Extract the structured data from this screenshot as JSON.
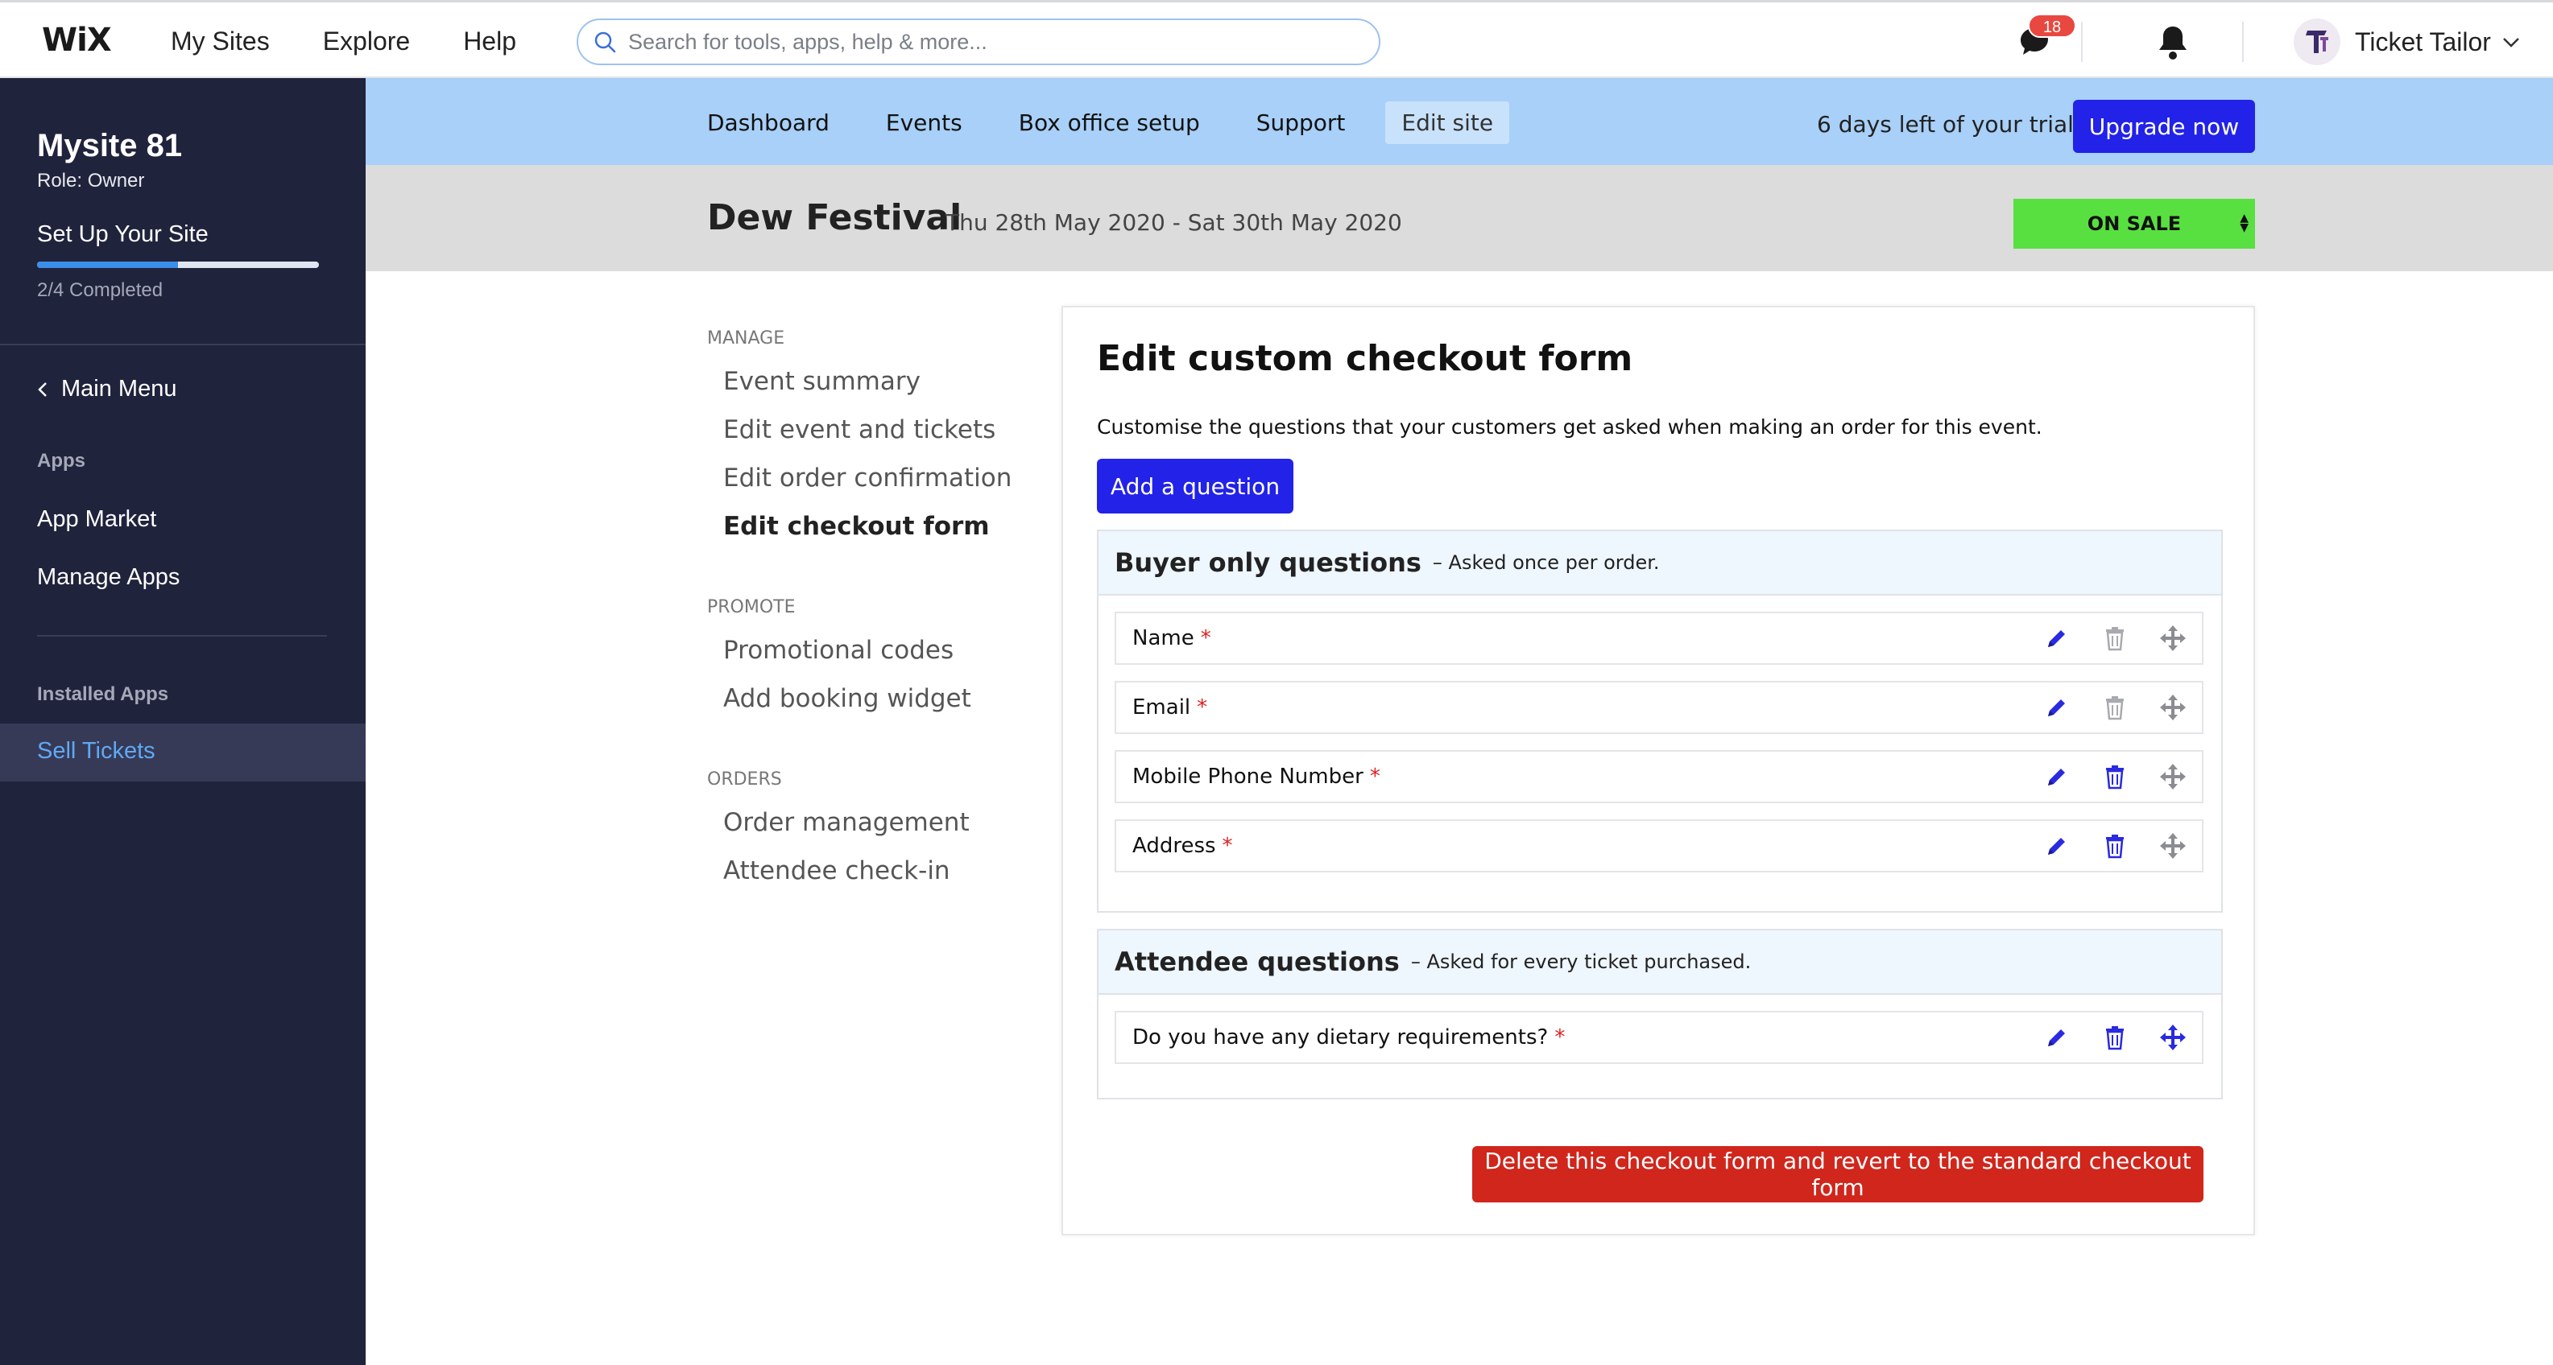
{
  "wix": {
    "logo": "WiX",
    "nav": [
      "My Sites",
      "Explore",
      "Help"
    ],
    "search_placeholder": "Search for tools, apps, help & more...",
    "notification_count": "18",
    "account_name": "Ticket Tailor"
  },
  "sidebar": {
    "site_name": "Mysite 81",
    "role": "Role: Owner",
    "setup_label": "Set Up Your Site",
    "progress_fraction": 0.5,
    "completed": "2/4 Completed",
    "main_menu": "Main Menu",
    "apps_label": "Apps",
    "app_market": "App Market",
    "manage_apps": "Manage Apps",
    "installed_label": "Installed Apps",
    "active_item": "Sell Tickets"
  },
  "appnav": {
    "links": [
      "Dashboard",
      "Events",
      "Box office setup",
      "Support",
      "Edit site"
    ],
    "active": "Edit site",
    "trial_text": "6 days left of your trial.",
    "upgrade_label": "Upgrade now"
  },
  "event": {
    "title": "Dew Festival",
    "dates": "Thu 28th May 2020 - Sat 30th May 2020",
    "status": "ON SALE"
  },
  "manage_menu": {
    "manage_head": "MANAGE",
    "manage_items": [
      "Event summary",
      "Edit event and tickets",
      "Edit order confirmation",
      "Edit checkout form"
    ],
    "promote_head": "PROMOTE",
    "promote_items": [
      "Promotional codes",
      "Add booking widget"
    ],
    "orders_head": "ORDERS",
    "orders_items": [
      "Order management",
      "Attendee check-in"
    ]
  },
  "form": {
    "title": "Edit custom checkout form",
    "description": "Customise the questions that your customers get asked when making an order for this event.",
    "add_question_label": "Add a question",
    "buyer_section": {
      "title": "Buyer only questions",
      "subtitle": "– Asked once per order.",
      "questions": [
        "Name",
        "Email",
        "Mobile Phone Number",
        "Address"
      ]
    },
    "attendee_section": {
      "title": "Attendee questions",
      "subtitle": "– Asked for every ticket purchased.",
      "questions": [
        "Do you have any dietary requirements?"
      ]
    },
    "required_marker": "*",
    "delete_label": "Delete this checkout form and revert to the standard checkout form"
  },
  "colors": {
    "primary_blue": "#2222e8",
    "nav_band": "#a8d0f8",
    "on_sale_green": "#58e040",
    "danger_red": "#d0261c",
    "sidebar_bg": "#20233c",
    "disabled_icon": "#a9aab0"
  }
}
